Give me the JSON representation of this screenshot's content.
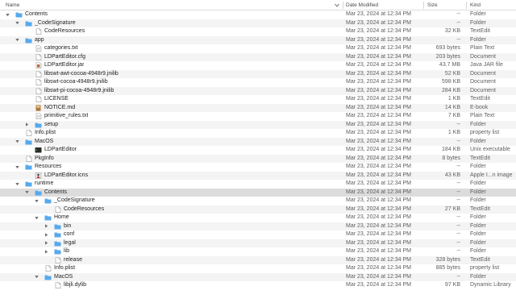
{
  "header": {
    "name": "Name",
    "date": "Date Modified",
    "size": "Size",
    "kind": "Kind"
  },
  "colors": {
    "folder": "#5fb0ef",
    "folder_tab": "#4a9fe6",
    "selected_row": "#dcdcdc",
    "alt_row": "#f4f4f4"
  },
  "rows": [
    {
      "name": "Contents",
      "level": 0,
      "icon": "folder-icon",
      "expanded": true,
      "date": "Mar 23, 2024 at 12:34 PM",
      "size": "--",
      "kind": "Folder"
    },
    {
      "name": "_CodeSignature",
      "level": 1,
      "icon": "folder-icon",
      "expanded": true,
      "date": "Mar 23, 2024 at 12:34 PM",
      "size": "--",
      "kind": "Folder"
    },
    {
      "name": "CodeResources",
      "level": 2,
      "icon": "document-icon",
      "date": "Mar 23, 2024 at 12:34 PM",
      "size": "32 KB",
      "kind": "TextEdit"
    },
    {
      "name": "app",
      "level": 1,
      "icon": "folder-icon",
      "expanded": true,
      "date": "Mar 23, 2024 at 12:34 PM",
      "size": "--",
      "kind": "Folder"
    },
    {
      "name": "categories.txt",
      "level": 2,
      "icon": "text-file-icon",
      "date": "Mar 23, 2024 at 12:34 PM",
      "size": "693 bytes",
      "kind": "Plain Text"
    },
    {
      "name": "LDPartEditor.cfg",
      "level": 2,
      "icon": "document-icon",
      "date": "Mar 23, 2024 at 12:34 PM",
      "size": "203 bytes",
      "kind": "Document"
    },
    {
      "name": "LDPartEditor.jar",
      "level": 2,
      "icon": "jar-icon",
      "date": "Mar 23, 2024 at 12:34 PM",
      "size": "43.7 MB",
      "kind": "Java JAR file"
    },
    {
      "name": "libswt-awt-cocoa-4948r9.jnilib",
      "level": 2,
      "icon": "document-icon",
      "date": "Mar 23, 2024 at 12:34 PM",
      "size": "52 KB",
      "kind": "Document"
    },
    {
      "name": "libswt-cocoa-4948r9.jnilib",
      "level": 2,
      "icon": "document-icon",
      "date": "Mar 23, 2024 at 12:34 PM",
      "size": "598 KB",
      "kind": "Document"
    },
    {
      "name": "libswt-pi-cocoa-4948r9.jnilib",
      "level": 2,
      "icon": "document-icon",
      "date": "Mar 23, 2024 at 12:34 PM",
      "size": "284 KB",
      "kind": "Document"
    },
    {
      "name": "LICENSE",
      "level": 2,
      "icon": "document-icon",
      "date": "Mar 23, 2024 at 12:34 PM",
      "size": "1 KB",
      "kind": "TextEdit"
    },
    {
      "name": "NOTICE.md",
      "level": 2,
      "icon": "ebook-icon",
      "date": "Mar 23, 2024 at 12:34 PM",
      "size": "14 KB",
      "kind": "E-book"
    },
    {
      "name": "primitive_rules.txt",
      "level": 2,
      "icon": "text-file-icon",
      "date": "Mar 23, 2024 at 12:34 PM",
      "size": "7 KB",
      "kind": "Plain Text"
    },
    {
      "name": "setup",
      "level": 2,
      "icon": "folder-icon",
      "expanded": false,
      "date": "Mar 23, 2024 at 12:34 PM",
      "size": "--",
      "kind": "Folder"
    },
    {
      "name": "Info.plist",
      "level": 1,
      "icon": "document-icon",
      "date": "Mar 23, 2024 at 12:34 PM",
      "size": "1 KB",
      "kind": "property list"
    },
    {
      "name": "MacOS",
      "level": 1,
      "icon": "folder-icon",
      "expanded": true,
      "date": "Mar 23, 2024 at 12:34 PM",
      "size": "--",
      "kind": "Folder"
    },
    {
      "name": "LDPartEditor",
      "level": 2,
      "icon": "executable-icon",
      "date": "Mar 23, 2024 at 12:34 PM",
      "size": "184 KB",
      "kind": "Unix executable"
    },
    {
      "name": "PkgInfo",
      "level": 1,
      "icon": "document-icon",
      "date": "Mar 23, 2024 at 12:34 PM",
      "size": "8 bytes",
      "kind": "TextEdit"
    },
    {
      "name": "Resources",
      "level": 1,
      "icon": "folder-icon",
      "expanded": true,
      "date": "Mar 23, 2024 at 12:34 PM",
      "size": "--",
      "kind": "Folder"
    },
    {
      "name": "LDPartEditor.icns",
      "level": 2,
      "icon": "app-icon-file",
      "date": "Mar 23, 2024 at 12:34 PM",
      "size": "43 KB",
      "kind": "Apple I...n image"
    },
    {
      "name": "runtime",
      "level": 1,
      "icon": "folder-icon",
      "expanded": true,
      "date": "Mar 23, 2024 at 12:34 PM",
      "size": "--",
      "kind": "Folder"
    },
    {
      "name": "Contents",
      "level": 2,
      "icon": "folder-icon",
      "expanded": true,
      "selected": true,
      "date": "Mar 23, 2024 at 12:34 PM",
      "size": "--",
      "kind": "Folder"
    },
    {
      "name": "_CodeSignature",
      "level": 3,
      "icon": "folder-icon",
      "expanded": true,
      "date": "Mar 23, 2024 at 12:34 PM",
      "size": "--",
      "kind": "Folder"
    },
    {
      "name": "CodeResources",
      "level": 4,
      "icon": "document-icon",
      "date": "Mar 23, 2024 at 12:34 PM",
      "size": "27 KB",
      "kind": "TextEdit"
    },
    {
      "name": "Home",
      "level": 3,
      "icon": "folder-icon",
      "expanded": true,
      "date": "Mar 23, 2024 at 12:34 PM",
      "size": "--",
      "kind": "Folder"
    },
    {
      "name": "bin",
      "level": 4,
      "icon": "folder-icon",
      "expanded": false,
      "date": "Mar 23, 2024 at 12:34 PM",
      "size": "--",
      "kind": "Folder"
    },
    {
      "name": "conf",
      "level": 4,
      "icon": "folder-icon",
      "expanded": false,
      "date": "Mar 23, 2024 at 12:34 PM",
      "size": "--",
      "kind": "Folder"
    },
    {
      "name": "legal",
      "level": 4,
      "icon": "folder-icon",
      "expanded": false,
      "date": "Mar 23, 2024 at 12:34 PM",
      "size": "--",
      "kind": "Folder"
    },
    {
      "name": "lib",
      "level": 4,
      "icon": "folder-icon",
      "expanded": false,
      "date": "Mar 23, 2024 at 12:34 PM",
      "size": "--",
      "kind": "Folder"
    },
    {
      "name": "release",
      "level": 4,
      "icon": "document-icon",
      "date": "Mar 23, 2024 at 12:34 PM",
      "size": "328 bytes",
      "kind": "TextEdit"
    },
    {
      "name": "Info.plist",
      "level": 3,
      "icon": "document-icon",
      "date": "Mar 23, 2024 at 12:34 PM",
      "size": "885 bytes",
      "kind": "property list"
    },
    {
      "name": "MacOS",
      "level": 3,
      "icon": "folder-icon",
      "expanded": true,
      "date": "Mar 23, 2024 at 12:34 PM",
      "size": "--",
      "kind": "Folder"
    },
    {
      "name": "libjli.dylib",
      "level": 4,
      "icon": "document-icon",
      "date": "Mar 23, 2024 at 12:34 PM",
      "size": "97 KB",
      "kind": "Dynamic Library"
    }
  ]
}
